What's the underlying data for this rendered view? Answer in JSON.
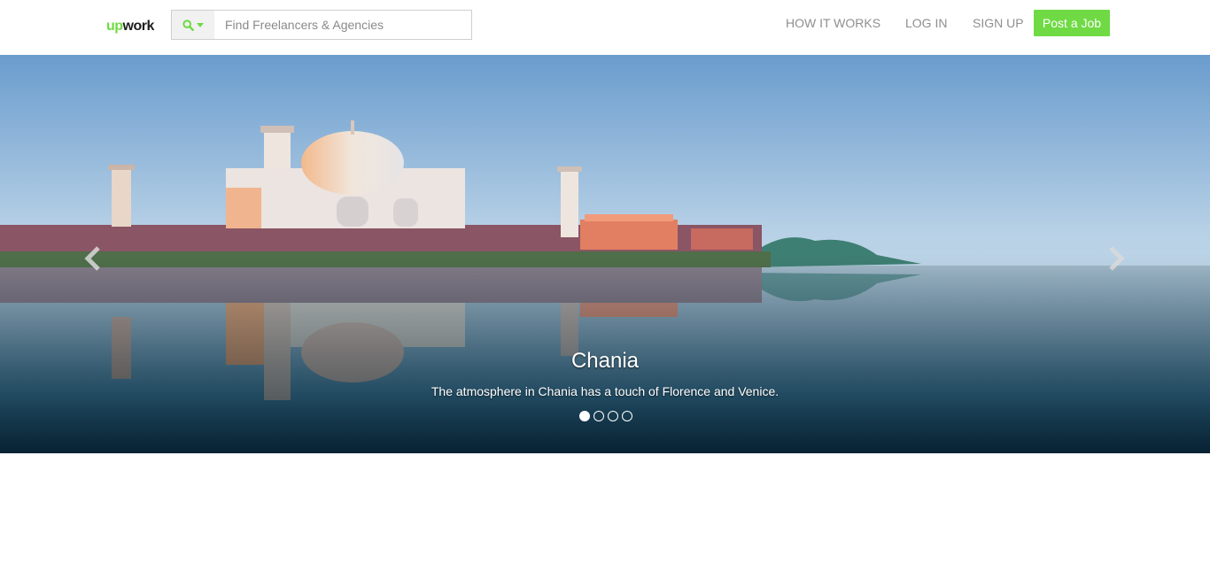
{
  "header": {
    "logo": {
      "up": "up",
      "work": "work"
    },
    "search": {
      "placeholder": "Find Freelancers & Agencies",
      "value": "",
      "icon": "search-icon"
    },
    "nav": {
      "how_it_works": "HOW IT WORKS",
      "log_in": "LOG IN",
      "sign_up": "SIGN UP",
      "post_job": "Post a Job"
    }
  },
  "carousel": {
    "caption_title": "Chania",
    "caption_text": "The atmosphere in Chania has a touch of Florence and Venice.",
    "slide_count": 4,
    "active_index": 0,
    "prev_icon": "chevron-left-icon",
    "next_icon": "chevron-right-icon"
  },
  "colors": {
    "brand_green": "#6fda44",
    "nav_text": "#8f8f8f"
  }
}
